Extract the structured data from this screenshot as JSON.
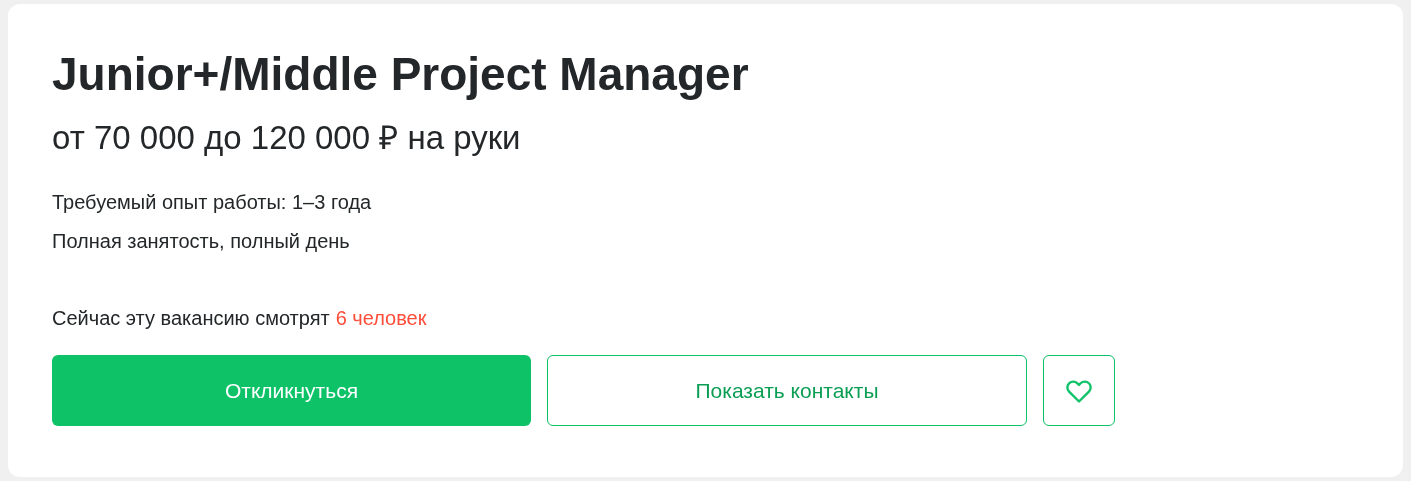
{
  "vacancy": {
    "title": "Junior+/Middle Project Manager",
    "salary": "от 70 000 до 120 000 ₽ на руки",
    "experience": "Требуемый опыт работы: 1–3 года",
    "employment": "Полная занятость, полный день",
    "viewers_text": "Сейчас эту вакансию смотрят",
    "viewers_count": "6 человек"
  },
  "buttons": {
    "apply": "Откликнуться",
    "contacts": "Показать контакты"
  }
}
